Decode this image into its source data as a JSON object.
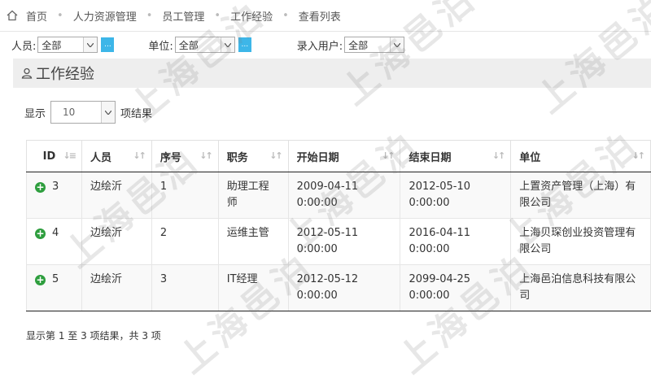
{
  "breadcrumb": [
    "首页",
    "人力资源管理",
    "员工管理",
    "工作经验",
    "查看列表"
  ],
  "filters": [
    {
      "label": "人员:",
      "value": "全部",
      "has_button": true
    },
    {
      "label": "单位:",
      "value": "全部",
      "has_button": true
    },
    {
      "label": "录入用户:",
      "value": "全部",
      "has_button": false
    }
  ],
  "filter_button_label": "...",
  "panel_title": "工作经验",
  "length": {
    "prefix": "显示",
    "value": "10",
    "suffix": "项结果"
  },
  "table": {
    "headers": [
      "ID",
      "人员",
      "序号",
      "职务",
      "开始日期",
      "结束日期",
      "单位"
    ],
    "rows": [
      [
        "3",
        "边绘沂",
        "1",
        "助理工程师",
        "2009-04-11 0:00:00",
        "2012-05-10 0:00:00",
        "上置资产管理（上海）有限公司"
      ],
      [
        "4",
        "边绘沂",
        "2",
        "运维主管",
        "2012-05-11 0:00:00",
        "2016-04-11 0:00:00",
        "上海贝琛创业投资管理有限公司"
      ],
      [
        "5",
        "边绘沂",
        "3",
        "IT经理",
        "2012-05-12 0:00:00",
        "2099-04-25 0:00:00",
        "上海邑泊信息科技有限公司"
      ]
    ]
  },
  "info": "显示第 1 至 3 项结果，共 3 项",
  "watermark": "上海邑泊",
  "colors": {
    "accent": "#3db6e8",
    "expand": "#2e9e3e",
    "panel": "#eeeeee"
  },
  "icons": {
    "home": "home-icon",
    "user": "user-icon",
    "expand": "plus-circle-icon"
  }
}
